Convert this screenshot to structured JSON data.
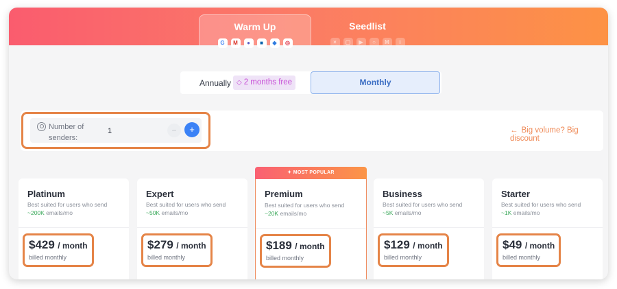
{
  "tabs": [
    {
      "label": "Warm Up",
      "icons": [
        "google-icon",
        "gmail-icon",
        "outlook-icon",
        "exchange-icon",
        "office365-icon",
        "target-icon"
      ]
    },
    {
      "label": "Seedlist",
      "icons": [
        "x-icon",
        "smtp-icon",
        "play-icon",
        "circle-icon",
        "mail-icon",
        "info-icon"
      ]
    }
  ],
  "billing": {
    "annually_label": "Annually",
    "free_badge": "2 months free",
    "monthly_label": "Monthly"
  },
  "senders": {
    "label": "Number of senders:",
    "value": "1",
    "minus": "−",
    "plus": "+"
  },
  "discount_link": "Big volume? Big discount",
  "popular_banner": "MOST POPULAR",
  "plans": [
    {
      "name": "Platinum",
      "desc": "Best suited for users who send",
      "volume": "~200K",
      "volume_suffix": "emails/mo",
      "price": "$429",
      "per": "/ month",
      "billed": "billed monthly"
    },
    {
      "name": "Expert",
      "desc": "Best suited for users who send",
      "volume": "~50K",
      "volume_suffix": "emails/mo",
      "price": "$279",
      "per": "/ month",
      "billed": "billed monthly"
    },
    {
      "name": "Premium",
      "desc": "Best suited for users who send",
      "volume": "~20K",
      "volume_suffix": "emails/mo",
      "price": "$189",
      "per": "/ month",
      "billed": "billed monthly"
    },
    {
      "name": "Business",
      "desc": "Best suited for users who send",
      "volume": "~5K",
      "volume_suffix": "emails/mo",
      "price": "$129",
      "per": "/ month",
      "billed": "billed monthly"
    },
    {
      "name": "Starter",
      "desc": "Best suited for users who send",
      "volume": "~1K",
      "volume_suffix": "emails/mo",
      "price": "$49",
      "per": "/ month",
      "billed": "billed monthly"
    }
  ],
  "colors": {
    "accent_orange": "#e58447",
    "header_gradient_start": "#fa5c6e",
    "header_gradient_end": "#fd9245",
    "primary_blue": "#3b82f6",
    "volume_green": "#3aa85a"
  }
}
